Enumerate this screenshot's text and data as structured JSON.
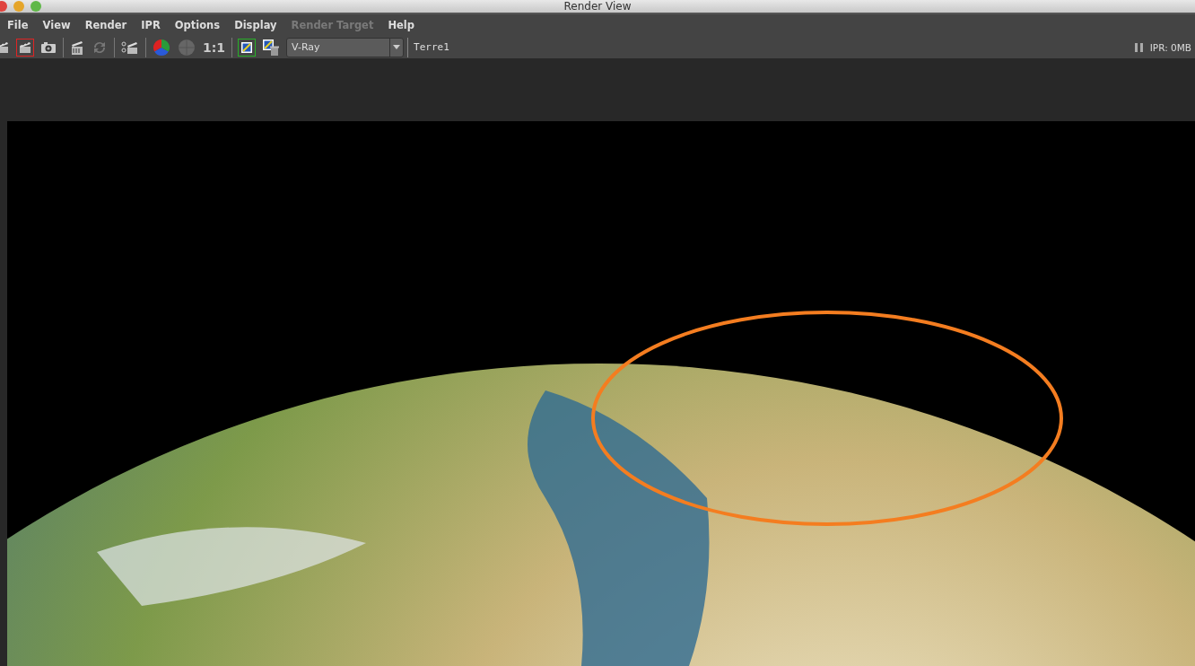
{
  "window": {
    "title": "Render View"
  },
  "menu": [
    {
      "label": "File",
      "disabled": false
    },
    {
      "label": "View",
      "disabled": false
    },
    {
      "label": "Render",
      "disabled": false
    },
    {
      "label": "IPR",
      "disabled": false
    },
    {
      "label": "Options",
      "disabled": false
    },
    {
      "label": "Display",
      "disabled": false
    },
    {
      "label": "Render Target",
      "disabled": true
    },
    {
      "label": "Help",
      "disabled": false
    }
  ],
  "toolbar": {
    "tools": [
      {
        "kind": "clapper"
      },
      {
        "kind": "clapper",
        "color": "#e02424"
      },
      {
        "kind": "camera"
      },
      {
        "kind": "sep"
      },
      {
        "kind": "ipr-clapper"
      },
      {
        "kind": "refresh"
      },
      {
        "kind": "sep"
      },
      {
        "kind": "region-clapper"
      },
      {
        "kind": "sep"
      },
      {
        "kind": "rgb"
      },
      {
        "kind": "gray"
      },
      {
        "kind": "text",
        "label": "1:1"
      },
      {
        "kind": "sep"
      },
      {
        "kind": "snapshot",
        "color": "#27b027"
      },
      {
        "kind": "snapshot-trash"
      }
    ],
    "renderer": {
      "value": "V-Ray"
    },
    "camera": "Terre1",
    "status": "IPR: 0MB"
  }
}
